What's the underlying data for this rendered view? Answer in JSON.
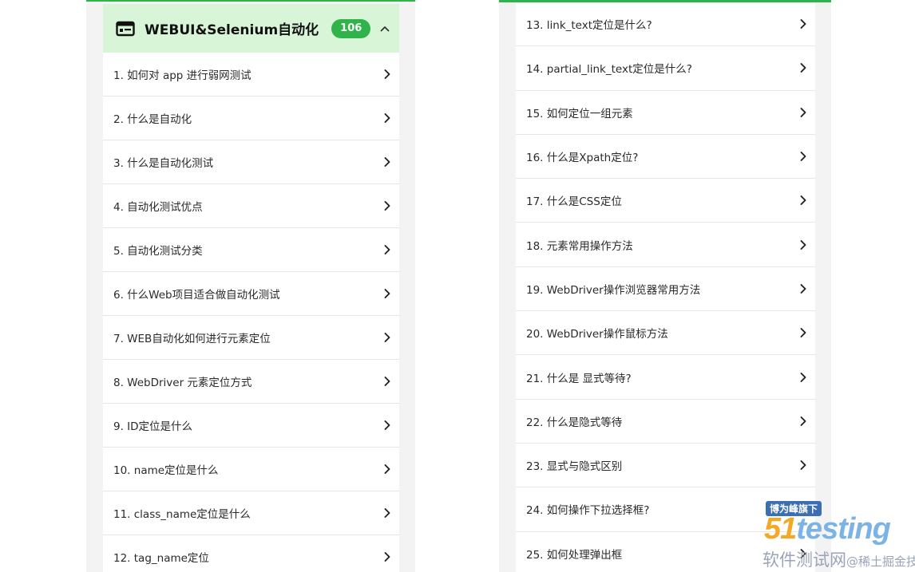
{
  "left_panel": {
    "header": {
      "title": "WEBUI&Selenium自动化",
      "count": "106"
    },
    "items": [
      "1. 如何对 app 进行弱网测试",
      "2. 什么是自动化",
      "3. 什么是自动化测试",
      "4. 自动化测试优点",
      "5. 自动化测试分类",
      "6. 什么Web项目适合做自动化测试",
      "7. WEB自动化如何进行元素定位",
      "8. WebDriver 元素定位方式",
      "9. ID定位是什么",
      "10. name定位是什么",
      "11. class_name定位是什么",
      "12. tag_name定位"
    ]
  },
  "right_panel": {
    "items": [
      "13. link_text定位是什么?",
      "14. partial_link_text定位是什么?",
      "15. 如何定位一组元素",
      "16. 什么是Xpath定位?",
      "17. 什么是CSS定位",
      "18. 元素常用操作方法",
      "19. WebDriver操作浏览器常用方法",
      "20. WebDriver操作鼠标方法",
      "21. 什么是 显式等待?",
      "22. 什么是隐式等待",
      "23. 显式与隐式区别",
      "24. 如何操作下拉选择框?",
      "25. 如何处理弹出框"
    ]
  },
  "watermark": {
    "tag": "博为峰旗下",
    "logo_num": "51",
    "logo_word": "testing",
    "subtitle": "软件测试网",
    "handle": "@稀土掘金技术社区"
  },
  "colors": {
    "accent": "#2fb34a",
    "header_bg": "#d9f5d8"
  }
}
